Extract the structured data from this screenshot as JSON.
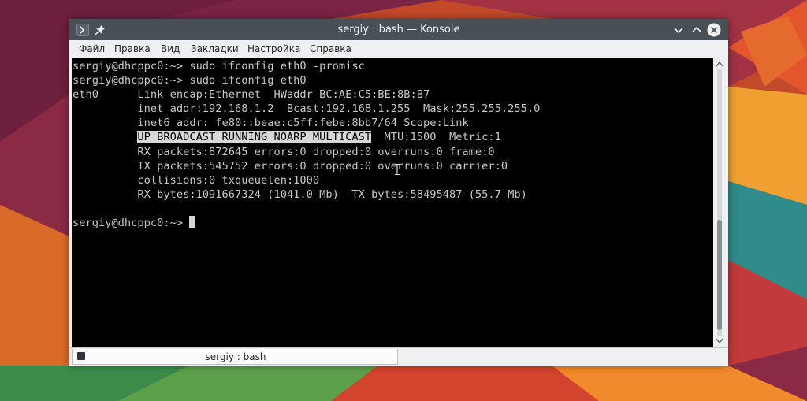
{
  "window": {
    "title": "sergiy : bash — Konsole",
    "titlebar_icons": [
      "terminal-app-icon",
      "pin-icon",
      "minimize-icon",
      "maximize-icon",
      "close-icon"
    ]
  },
  "menu": {
    "file": "Файл",
    "edit": "Правка",
    "view": "Вид",
    "bookmarks": "Закладки",
    "settings": "Настройка",
    "help": "Справка"
  },
  "terminal": {
    "line1": "sergiy@dhcppc0:~> sudo ifconfig eth0 -promisc",
    "line2": "sergiy@dhcppc0:~> sudo ifconfig eth0",
    "line3": "eth0      Link encap:Ethernet  HWaddr BC:AE:C5:BE:8B:B7  ",
    "line4": "          inet addr:192.168.1.2  Bcast:192.168.1.255  Mask:255.255.255.0",
    "line5": "          inet6 addr: fe80::beae:c5ff:febe:8bb7/64 Scope:Link",
    "line6_prefix": "          ",
    "line6_highlight": "UP BROADCAST RUNNING NOARP MULTICAST",
    "line6_suffix": "  MTU:1500  Metric:1",
    "line7": "          RX packets:872645 errors:0 dropped:0 overruns:0 frame:0",
    "line8": "          TX packets:545752 errors:0 dropped:0 overruns:0 carrier:0",
    "line9": "          collisions:0 txqueuelen:1000 ",
    "line10": "          RX bytes:1091667324 (1041.0 Mb)  TX bytes:58495487 (55.7 Mb)",
    "line11": "",
    "prompt": "sergiy@dhcppc0:~> "
  },
  "tab": {
    "label": "sergiy : bash"
  },
  "colors": {
    "titlebar": "#475057",
    "terminal_bg": "#000000",
    "terminal_fg": "#c7c7c7",
    "selection_bg": "#d8d8d8"
  }
}
